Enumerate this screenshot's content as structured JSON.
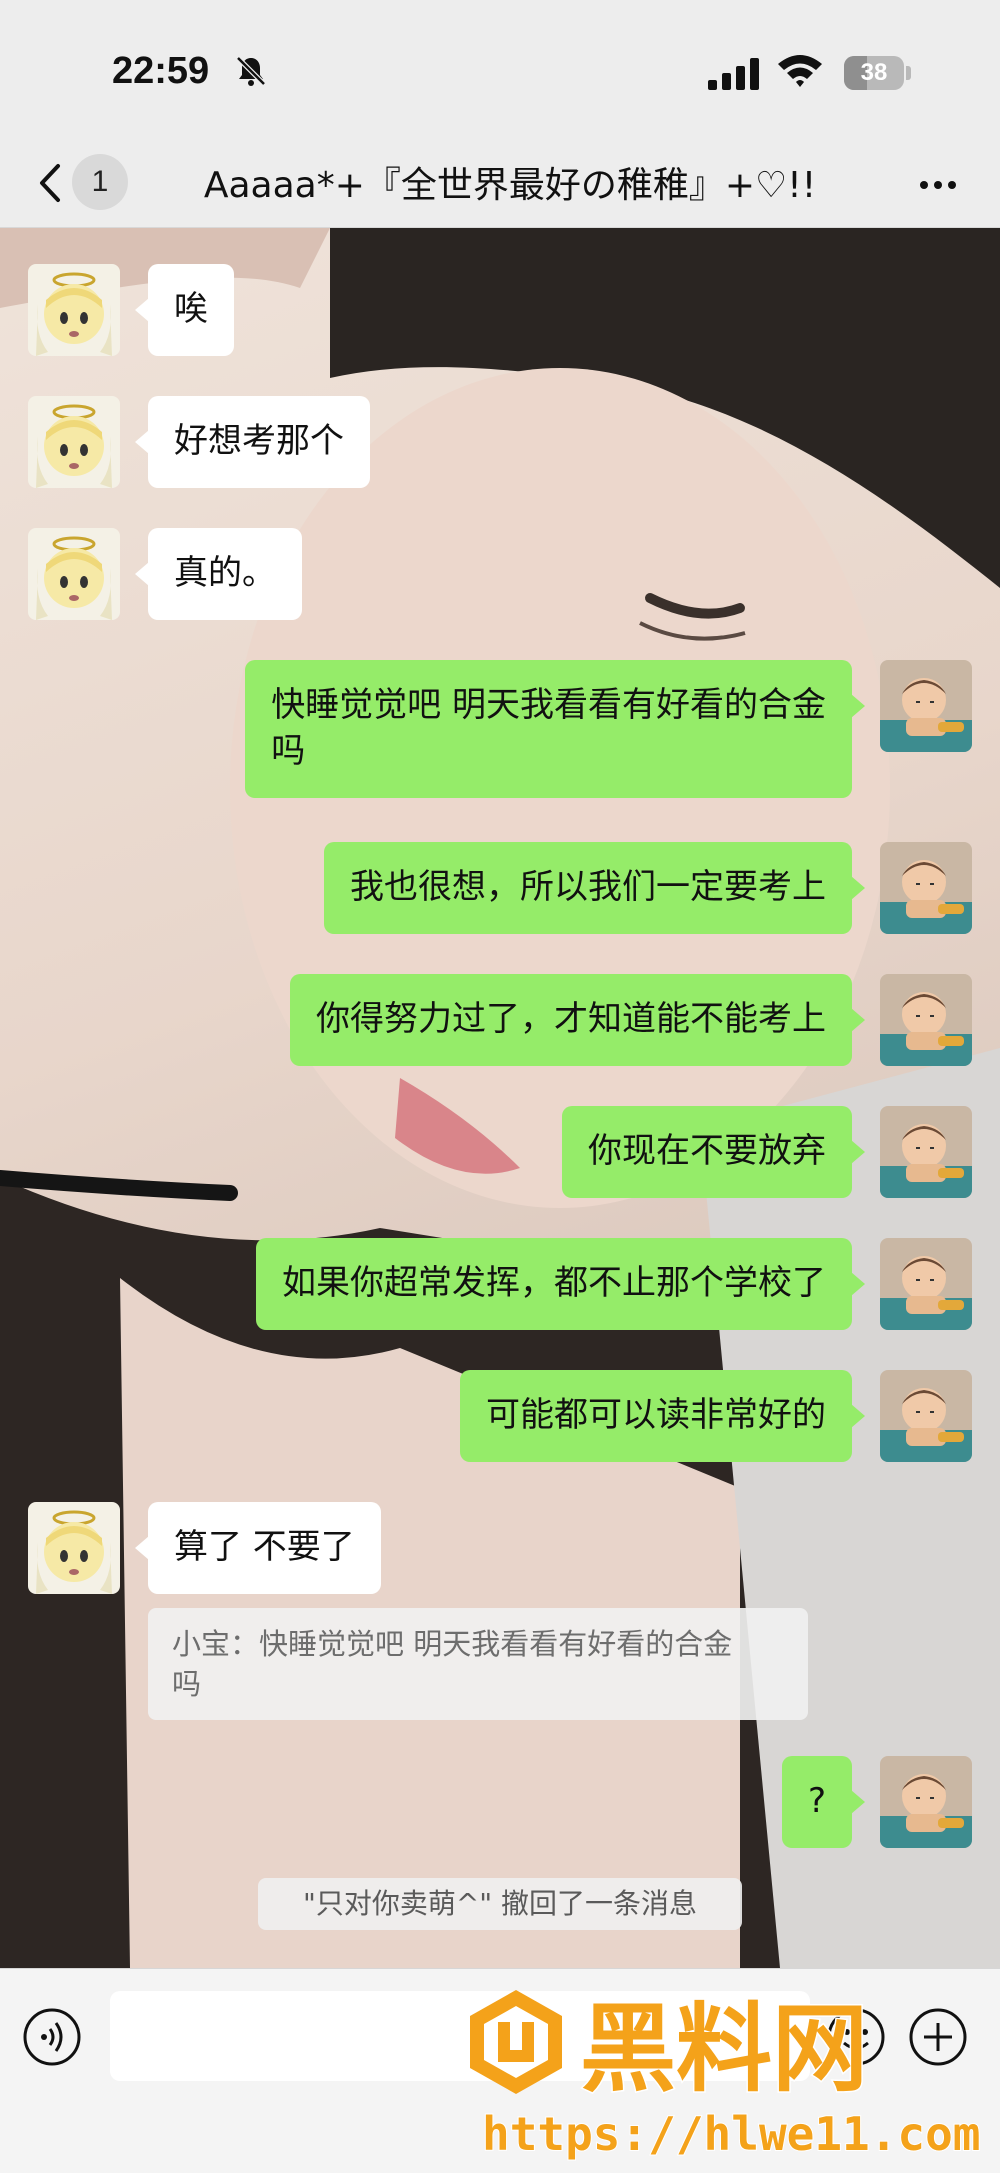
{
  "status_bar": {
    "time": "22:59",
    "battery": "38",
    "battery_level": 0.38
  },
  "nav": {
    "back_count": "1",
    "title": "Aaaaa*+『全世界最好の稚稚』+♡!!"
  },
  "messages": [
    {
      "side": "left",
      "text": "唉"
    },
    {
      "side": "left",
      "text": "好想考那个"
    },
    {
      "side": "left",
      "text": "真的。"
    },
    {
      "side": "right",
      "text_line1": "快睡觉觉吧 明天我看看有好看的合金",
      "text_line2": "吗"
    },
    {
      "side": "right",
      "text": "我也很想，所以我们一定要考上"
    },
    {
      "side": "right",
      "text": "你得努力过了，才知道能不能考上"
    },
    {
      "side": "right",
      "text": "你现在不要放弃"
    },
    {
      "side": "right",
      "text": "如果你超常发挥，都不止那个学校了"
    },
    {
      "side": "right",
      "text": "可能都可以读非常好的"
    },
    {
      "side": "left",
      "text": "算了 不要了"
    },
    {
      "side": "right",
      "text": "?"
    }
  ],
  "quote": {
    "line1": "小宝：快睡觉觉吧 明天我看看有好看的合金",
    "line2": "吗"
  },
  "system_notice": "\"只对你卖萌^\" 撤回了一条消息",
  "watermark": {
    "name": "黑料网",
    "url": "https://hlwe11.com"
  },
  "icons": {
    "back": "chevron-left-icon",
    "more": "more-dots-icon",
    "voice": "voice-icon",
    "emoji": "emoji-icon",
    "plus": "plus-icon",
    "mute": "bell-slash-icon",
    "signal": "signal-icon",
    "wifi": "wifi-icon"
  },
  "colors": {
    "sent_bubble": "#95ec69",
    "received_bubble": "#ffffff",
    "watermark": "#f4a21a"
  }
}
